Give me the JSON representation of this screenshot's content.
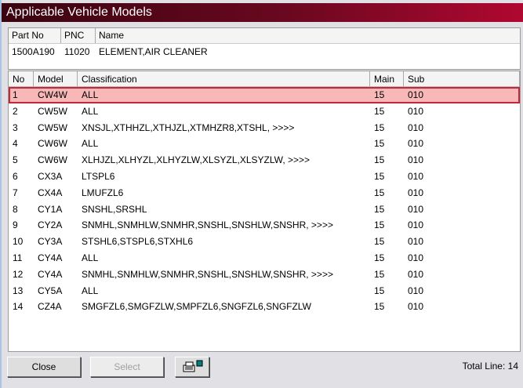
{
  "title": "Applicable Vehicle Models",
  "part": {
    "headers": [
      "Part No",
      "PNC",
      "Name"
    ],
    "values": [
      "1500A190",
      "11020",
      "ELEMENT,AIR CLEANER"
    ]
  },
  "grid": {
    "headers": [
      "No",
      "Model",
      "Classification",
      "Main",
      "Sub"
    ],
    "rows": [
      [
        "1",
        "CW4W",
        "ALL",
        "15",
        "010"
      ],
      [
        "2",
        "CW5W",
        "ALL",
        "15",
        "010"
      ],
      [
        "3",
        "CW5W",
        "XNSJL,XTHHZL,XTHJZL,XTMHZR8,XTSHL,  >>>>",
        "15",
        "010"
      ],
      [
        "4",
        "CW6W",
        "ALL",
        "15",
        "010"
      ],
      [
        "5",
        "CW6W",
        "XLHJZL,XLHYZL,XLHYZLW,XLSYZL,XLSYZLW,  >>>>",
        "15",
        "010"
      ],
      [
        "6",
        "CX3A",
        "LTSPL6",
        "15",
        "010"
      ],
      [
        "7",
        "CX4A",
        "LMUFZL6",
        "15",
        "010"
      ],
      [
        "8",
        "CY1A",
        "SNSHL,SRSHL",
        "15",
        "010"
      ],
      [
        "9",
        "CY2A",
        "SNMHL,SNMHLW,SNMHR,SNSHL,SNSHLW,SNSHR,  >>>>",
        "15",
        "010"
      ],
      [
        "10",
        "CY3A",
        "STSHL6,STSPL6,STXHL6",
        "15",
        "010"
      ],
      [
        "11",
        "CY4A",
        "ALL",
        "15",
        "010"
      ],
      [
        "12",
        "CY4A",
        "SNMHL,SNMHLW,SNMHR,SNSHL,SNSHLW,SNSHR,  >>>>",
        "15",
        "010"
      ],
      [
        "13",
        "CY5A",
        "ALL",
        "15",
        "010"
      ],
      [
        "14",
        "CZ4A",
        "SMGFZL6,SMGFZLW,SMPFZL6,SNGFZL6,SNGFZLW",
        "15",
        "010"
      ]
    ]
  },
  "buttons": {
    "close": "Close",
    "select": "Select",
    "print_icon": "printer-icon"
  },
  "total": "Total Line: 14"
}
